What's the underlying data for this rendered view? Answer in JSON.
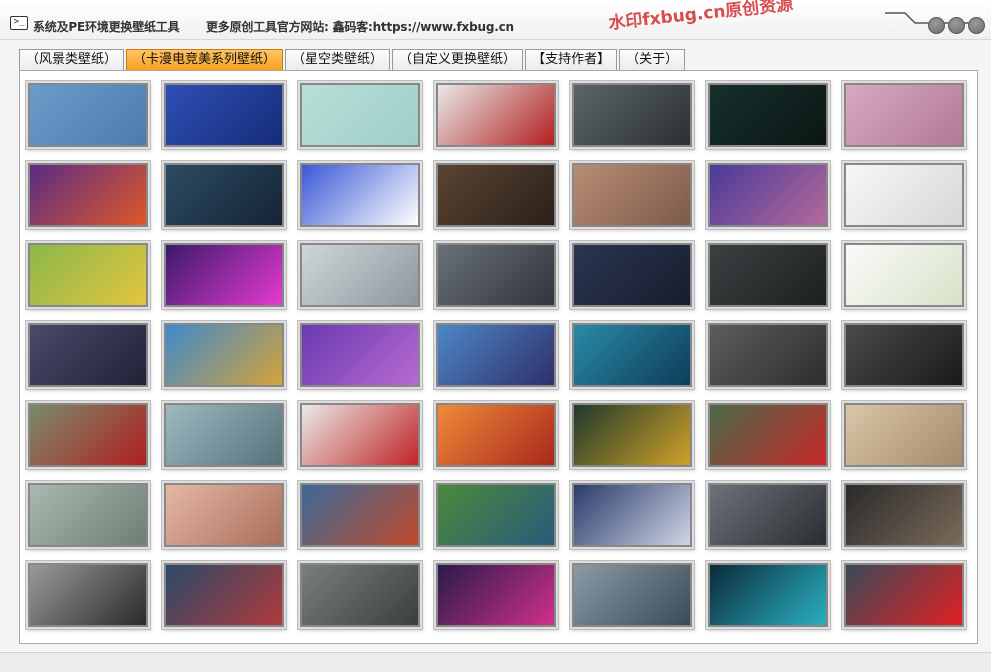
{
  "window": {
    "title": "系统及PE环境更换壁纸工具",
    "website": "更多原创工具官方网站: 鑫码客:https://www.fxbug.cn",
    "watermark": "水印fxbug.cn原创资源"
  },
  "tabs": [
    {
      "label": "（风景类壁纸）",
      "active": false
    },
    {
      "label": "（卡漫电竞美系列壁纸）",
      "active": true
    },
    {
      "label": "（星空类壁纸）",
      "active": false
    },
    {
      "label": "（自定义更换壁纸）",
      "active": false
    },
    {
      "label": "【支持作者】",
      "active": false
    },
    {
      "label": "（关于）",
      "active": false
    }
  ],
  "wallpapers": [
    {
      "subject": "bonsai tree on blue",
      "colors": [
        "#6a9cc9",
        "#4c7cae"
      ]
    },
    {
      "subject": "3d robot figure",
      "colors": [
        "#2f4fb5",
        "#162c7a"
      ]
    },
    {
      "subject": "birds on wire",
      "colors": [
        "#b9ded8",
        "#9ecfc7"
      ]
    },
    {
      "subject": "yin yang warriors",
      "colors": [
        "#e9e9e9",
        "#b32020"
      ]
    },
    {
      "subject": "keyboard desk",
      "colors": [
        "#5c6466",
        "#2b3133"
      ]
    },
    {
      "subject": "dark room scene",
      "colors": [
        "#16302c",
        "#0b1614"
      ]
    },
    {
      "subject": "girl sitting on chair",
      "colors": [
        "#d9a8bf",
        "#b07a98"
      ]
    },
    {
      "subject": "cartoon characters",
      "colors": [
        "#5a2c82",
        "#e0572a"
      ]
    },
    {
      "subject": "dark haired girl",
      "colors": [
        "#2c4b63",
        "#152433"
      ]
    },
    {
      "subject": "anime fighter",
      "colors": [
        "#3a58d6",
        "#ffffff"
      ]
    },
    {
      "subject": "girl sitting rooftop",
      "colors": [
        "#5a4433",
        "#2b2019"
      ]
    },
    {
      "subject": "girl in classroom",
      "colors": [
        "#b98d74",
        "#7b5a49"
      ]
    },
    {
      "subject": "girl night sky",
      "colors": [
        "#4a3a9a",
        "#b36a9a"
      ]
    },
    {
      "subject": "anime girl lying",
      "colors": [
        "#f7f7f7",
        "#d7d7d7"
      ]
    },
    {
      "subject": "doraemon",
      "colors": [
        "#8cb84a",
        "#e3c53e"
      ]
    },
    {
      "subject": "neon runner",
      "colors": [
        "#3a1a6a",
        "#e53ad0"
      ]
    },
    {
      "subject": "girl lying down",
      "colors": [
        "#cfd6da",
        "#8d979c"
      ]
    },
    {
      "subject": "girl long hair",
      "colors": [
        "#6a7078",
        "#30353b"
      ]
    },
    {
      "subject": "akatsuki group",
      "colors": [
        "#2a3550",
        "#171d2e"
      ]
    },
    {
      "subject": "dark character",
      "colors": [
        "#3b4142",
        "#1c2021"
      ]
    },
    {
      "subject": "girl with umbrella",
      "colors": [
        "#fafafa",
        "#d7e2c7"
      ]
    },
    {
      "subject": "city window girl",
      "colors": [
        "#4a4a6a",
        "#212136"
      ]
    },
    {
      "subject": "luffy",
      "colors": [
        "#3f8acb",
        "#d4a23a"
      ]
    },
    {
      "subject": "spider gwen",
      "colors": [
        "#6a3ab0",
        "#b76ad1"
      ]
    },
    {
      "subject": "spider miles",
      "colors": [
        "#4d87c7",
        "#2f2f6a"
      ]
    },
    {
      "subject": "whale sky",
      "colors": [
        "#2a8aa6",
        "#0d3d5a"
      ]
    },
    {
      "subject": "girl on bed",
      "colors": [
        "#5a5c5e",
        "#2c2e30"
      ]
    },
    {
      "subject": "motorcycle",
      "colors": [
        "#4a4a4a",
        "#1a1a1a"
      ]
    },
    {
      "subject": "red sports car house",
      "colors": [
        "#7a8a6a",
        "#b02020"
      ]
    },
    {
      "subject": "car on road",
      "colors": [
        "#9fb9c1",
        "#55717a"
      ]
    },
    {
      "subject": "woman in red dress",
      "colors": [
        "#e9e9e9",
        "#c02424"
      ]
    },
    {
      "subject": "sunset tree",
      "colors": [
        "#f08a3a",
        "#a8281a"
      ]
    },
    {
      "subject": "robot character",
      "colors": [
        "#1e3a2a",
        "#d0a02a"
      ]
    },
    {
      "subject": "race cars",
      "colors": [
        "#4a6a4a",
        "#c62828"
      ]
    },
    {
      "subject": "girl sunlight room",
      "colors": [
        "#d9c6a8",
        "#a58a6a"
      ]
    },
    {
      "subject": "ink painting girl",
      "colors": [
        "#a9b9b0",
        "#6c7f75"
      ]
    },
    {
      "subject": "fox girl pink",
      "colors": [
        "#e6b7a6",
        "#a86e5a"
      ]
    },
    {
      "subject": "spiderman battle",
      "colors": [
        "#3a6a9a",
        "#c04a2a"
      ]
    },
    {
      "subject": "anime field scene",
      "colors": [
        "#4a8a3a",
        "#2a5a7a"
      ]
    },
    {
      "subject": "anime girl night street",
      "colors": [
        "#2a3a6a",
        "#cfd6e6"
      ]
    },
    {
      "subject": "dark reaper",
      "colors": [
        "#6c7278",
        "#2a2e33"
      ]
    },
    {
      "subject": "vintage camera",
      "colors": [
        "#2a2a2a",
        "#7a6a5a"
      ]
    },
    {
      "subject": "concept supercar",
      "colors": [
        "#9a9a9a",
        "#2a2a2a"
      ]
    },
    {
      "subject": "cyberpunk girl",
      "colors": [
        "#2a4a6a",
        "#b03a3a"
      ]
    },
    {
      "subject": "car front",
      "colors": [
        "#7a7e7e",
        "#3a3e3e"
      ]
    },
    {
      "subject": "neon mask",
      "colors": [
        "#2a1a4a",
        "#d0308a"
      ]
    },
    {
      "subject": "snowy landscape",
      "colors": [
        "#8a9aa6",
        "#3a4a56"
      ]
    },
    {
      "subject": "cyber motorcycle",
      "colors": [
        "#0a2a3a",
        "#2ab0c0"
      ]
    },
    {
      "subject": "red blade warrior",
      "colors": [
        "#3a4a5a",
        "#e02020"
      ]
    }
  ]
}
